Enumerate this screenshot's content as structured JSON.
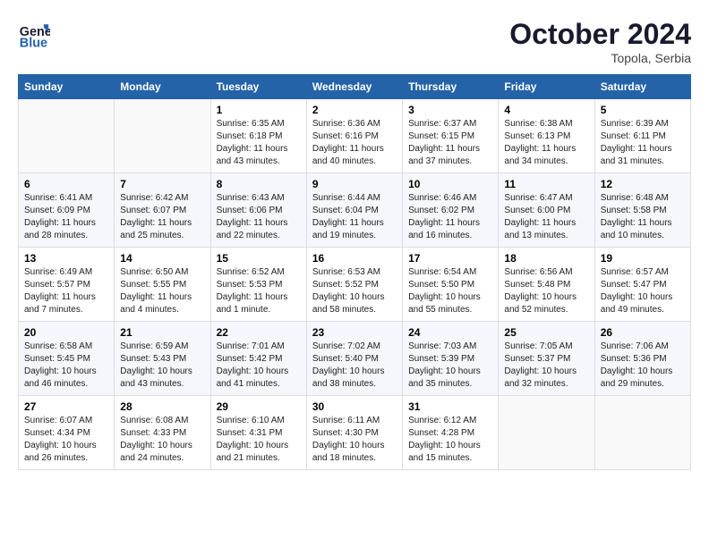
{
  "logo": {
    "text_general": "General",
    "text_blue": "Blue"
  },
  "header": {
    "month": "October 2024",
    "location": "Topola, Serbia"
  },
  "weekdays": [
    "Sunday",
    "Monday",
    "Tuesday",
    "Wednesday",
    "Thursday",
    "Friday",
    "Saturday"
  ],
  "weeks": [
    [
      {
        "day": "",
        "info": ""
      },
      {
        "day": "",
        "info": ""
      },
      {
        "day": "1",
        "info": "Sunrise: 6:35 AM\nSunset: 6:18 PM\nDaylight: 11 hours and 43 minutes."
      },
      {
        "day": "2",
        "info": "Sunrise: 6:36 AM\nSunset: 6:16 PM\nDaylight: 11 hours and 40 minutes."
      },
      {
        "day": "3",
        "info": "Sunrise: 6:37 AM\nSunset: 6:15 PM\nDaylight: 11 hours and 37 minutes."
      },
      {
        "day": "4",
        "info": "Sunrise: 6:38 AM\nSunset: 6:13 PM\nDaylight: 11 hours and 34 minutes."
      },
      {
        "day": "5",
        "info": "Sunrise: 6:39 AM\nSunset: 6:11 PM\nDaylight: 11 hours and 31 minutes."
      }
    ],
    [
      {
        "day": "6",
        "info": "Sunrise: 6:41 AM\nSunset: 6:09 PM\nDaylight: 11 hours and 28 minutes."
      },
      {
        "day": "7",
        "info": "Sunrise: 6:42 AM\nSunset: 6:07 PM\nDaylight: 11 hours and 25 minutes."
      },
      {
        "day": "8",
        "info": "Sunrise: 6:43 AM\nSunset: 6:06 PM\nDaylight: 11 hours and 22 minutes."
      },
      {
        "day": "9",
        "info": "Sunrise: 6:44 AM\nSunset: 6:04 PM\nDaylight: 11 hours and 19 minutes."
      },
      {
        "day": "10",
        "info": "Sunrise: 6:46 AM\nSunset: 6:02 PM\nDaylight: 11 hours and 16 minutes."
      },
      {
        "day": "11",
        "info": "Sunrise: 6:47 AM\nSunset: 6:00 PM\nDaylight: 11 hours and 13 minutes."
      },
      {
        "day": "12",
        "info": "Sunrise: 6:48 AM\nSunset: 5:58 PM\nDaylight: 11 hours and 10 minutes."
      }
    ],
    [
      {
        "day": "13",
        "info": "Sunrise: 6:49 AM\nSunset: 5:57 PM\nDaylight: 11 hours and 7 minutes."
      },
      {
        "day": "14",
        "info": "Sunrise: 6:50 AM\nSunset: 5:55 PM\nDaylight: 11 hours and 4 minutes."
      },
      {
        "day": "15",
        "info": "Sunrise: 6:52 AM\nSunset: 5:53 PM\nDaylight: 11 hours and 1 minute."
      },
      {
        "day": "16",
        "info": "Sunrise: 6:53 AM\nSunset: 5:52 PM\nDaylight: 10 hours and 58 minutes."
      },
      {
        "day": "17",
        "info": "Sunrise: 6:54 AM\nSunset: 5:50 PM\nDaylight: 10 hours and 55 minutes."
      },
      {
        "day": "18",
        "info": "Sunrise: 6:56 AM\nSunset: 5:48 PM\nDaylight: 10 hours and 52 minutes."
      },
      {
        "day": "19",
        "info": "Sunrise: 6:57 AM\nSunset: 5:47 PM\nDaylight: 10 hours and 49 minutes."
      }
    ],
    [
      {
        "day": "20",
        "info": "Sunrise: 6:58 AM\nSunset: 5:45 PM\nDaylight: 10 hours and 46 minutes."
      },
      {
        "day": "21",
        "info": "Sunrise: 6:59 AM\nSunset: 5:43 PM\nDaylight: 10 hours and 43 minutes."
      },
      {
        "day": "22",
        "info": "Sunrise: 7:01 AM\nSunset: 5:42 PM\nDaylight: 10 hours and 41 minutes."
      },
      {
        "day": "23",
        "info": "Sunrise: 7:02 AM\nSunset: 5:40 PM\nDaylight: 10 hours and 38 minutes."
      },
      {
        "day": "24",
        "info": "Sunrise: 7:03 AM\nSunset: 5:39 PM\nDaylight: 10 hours and 35 minutes."
      },
      {
        "day": "25",
        "info": "Sunrise: 7:05 AM\nSunset: 5:37 PM\nDaylight: 10 hours and 32 minutes."
      },
      {
        "day": "26",
        "info": "Sunrise: 7:06 AM\nSunset: 5:36 PM\nDaylight: 10 hours and 29 minutes."
      }
    ],
    [
      {
        "day": "27",
        "info": "Sunrise: 6:07 AM\nSunset: 4:34 PM\nDaylight: 10 hours and 26 minutes."
      },
      {
        "day": "28",
        "info": "Sunrise: 6:08 AM\nSunset: 4:33 PM\nDaylight: 10 hours and 24 minutes."
      },
      {
        "day": "29",
        "info": "Sunrise: 6:10 AM\nSunset: 4:31 PM\nDaylight: 10 hours and 21 minutes."
      },
      {
        "day": "30",
        "info": "Sunrise: 6:11 AM\nSunset: 4:30 PM\nDaylight: 10 hours and 18 minutes."
      },
      {
        "day": "31",
        "info": "Sunrise: 6:12 AM\nSunset: 4:28 PM\nDaylight: 10 hours and 15 minutes."
      },
      {
        "day": "",
        "info": ""
      },
      {
        "day": "",
        "info": ""
      }
    ]
  ]
}
